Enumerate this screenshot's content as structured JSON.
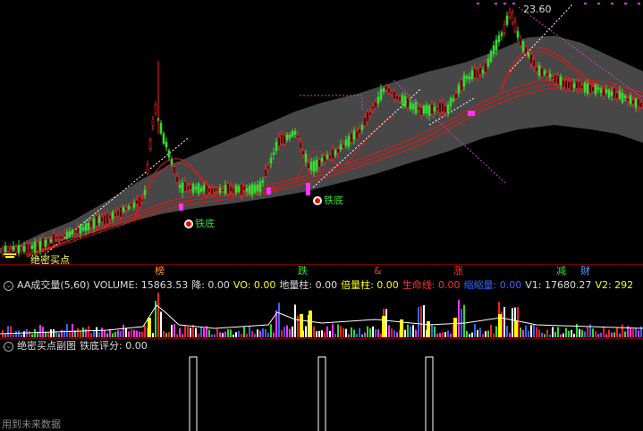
{
  "colors": {
    "up": "#ff2020",
    "down": "#33dd33",
    "magenta": "#ff33ff",
    "yellow": "#ffff00",
    "band": "#4a4a4a",
    "bg": "#000000",
    "sep": "#7a0000"
  },
  "main": {
    "price_high_label": "23.60",
    "buy_label": "绝密买点",
    "tiedi_labels": [
      "铁底",
      "铁底"
    ]
  },
  "marker_tags": [
    {
      "text": "榜",
      "color": "#ff9933"
    },
    {
      "text": "跌",
      "color": "#33dd33"
    },
    {
      "text": "&",
      "color": "#ff3333"
    },
    {
      "text": "涨",
      "color": "#ff3333"
    },
    {
      "text": "减",
      "color": "#33dd33"
    },
    {
      "text": "财",
      "color": "#6699ff"
    }
  ],
  "volume_header": {
    "collapse_icon": "collapse-icon",
    "title": "AA成交量(5,60)",
    "items": [
      {
        "label": "VOLUME: 15863.53",
        "color": "#dddddd"
      },
      {
        "label": "降: 0.00",
        "color": "#dddddd"
      },
      {
        "label": "VO: 0.00",
        "color": "#ffff00"
      },
      {
        "label": "地量柱: 0.00",
        "color": "#dddddd"
      },
      {
        "label": "倍量柱: 0.00",
        "color": "#ffff00"
      },
      {
        "label": "生命线: 0.00",
        "color": "#ff3333"
      },
      {
        "label": "缩缩量: 0.00",
        "color": "#3366ff"
      },
      {
        "label": "V1: 17680.27",
        "color": "#dddddd"
      },
      {
        "label": "V2: 292",
        "color": "#ffff00"
      }
    ]
  },
  "sub_header": {
    "collapse_icon": "collapse-icon",
    "title": "绝密买点副图",
    "score": "铁底评分: 0.00"
  },
  "watermark": "用到未来数据"
}
